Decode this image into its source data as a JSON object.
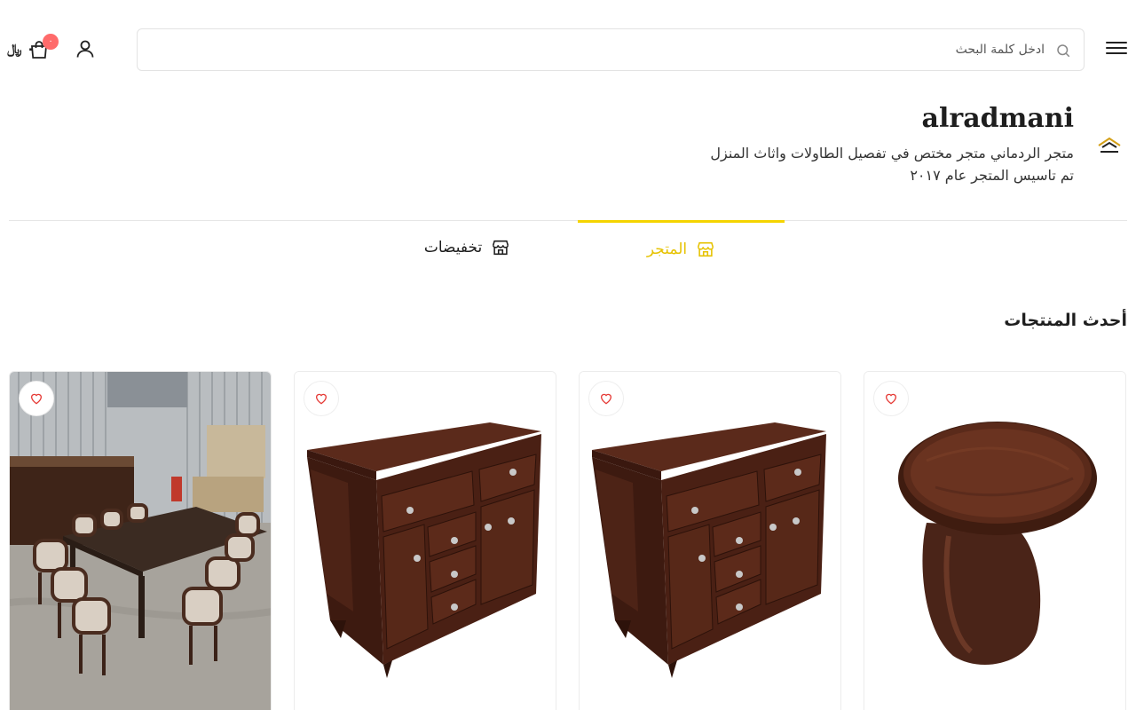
{
  "header": {
    "search_placeholder": "ادخل كلمة البحث",
    "cart_count": "٠",
    "cart_total": "٠ ﷼"
  },
  "store": {
    "name": "alradmani",
    "description": "متجر الردماني متجر مختص في تفصيل الطاولات واثاث المنزل تم تاسيس المتجر عام ٢٠١٧"
  },
  "tabs": [
    {
      "label": "المتجر",
      "active": true
    },
    {
      "label": "تخفيضات",
      "active": false
    }
  ],
  "section": {
    "title": "أحدث المنتجات"
  },
  "products": [
    {
      "image": "round-wooden-side-table"
    },
    {
      "image": "wooden-sideboard-cabinet"
    },
    {
      "image": "wooden-sideboard-cabinet"
    },
    {
      "image": "dining-table-with-chairs-in-workshop"
    }
  ],
  "colors": {
    "accent": "#f5d400",
    "badge": "#ff6b6b",
    "heart": "#e53935"
  }
}
